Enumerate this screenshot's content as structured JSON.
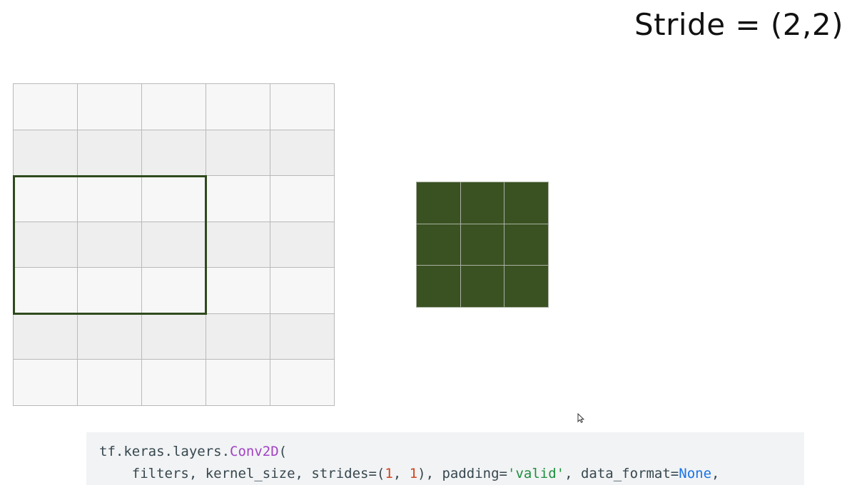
{
  "title": "Stride = (2,2)",
  "input_grid": {
    "rows": 7,
    "cols": 5,
    "cell_color_light": "#f7f7f7",
    "cell_color_dark": "#eeeeee",
    "border_color": "#b9b9b9"
  },
  "kernel_window": {
    "row": 2,
    "col": 0,
    "rows": 3,
    "cols": 3,
    "color": "#2f4a1e"
  },
  "output_grid": {
    "rows": 3,
    "cols": 3,
    "fill_color": "#3a5222",
    "border_color": "#a9b0a3"
  },
  "code": {
    "line1": {
      "prefix": "tf.keras.layers.",
      "fn": "Conv2D",
      "suffix": "("
    },
    "line2": {
      "indent": "    ",
      "t1": "filters, kernel_size, strides=(",
      "n1": "1",
      "t2": ", ",
      "n2": "1",
      "t3": "), padding=",
      "s1": "'valid'",
      "t4": ", data_format=",
      "k1": "None",
      "t5": ","
    }
  },
  "cursor_icon": "mouse-pointer-icon"
}
